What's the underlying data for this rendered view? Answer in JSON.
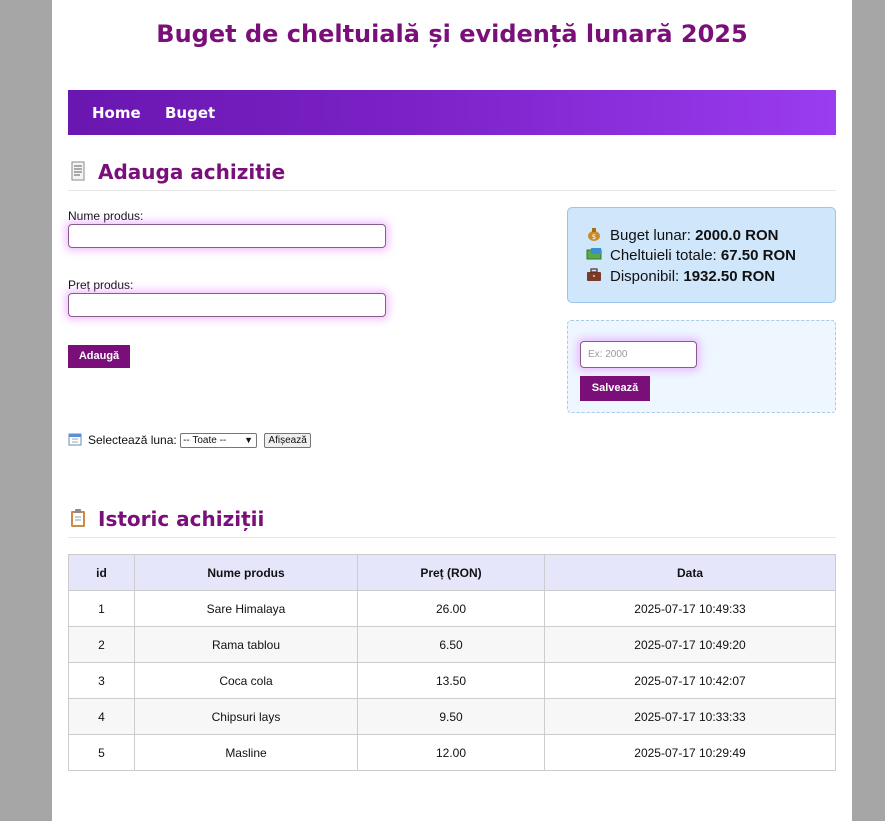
{
  "header": {
    "title": "Buget de cheltuială și evidență lunară 2025"
  },
  "nav": {
    "items": [
      {
        "label": "Home"
      },
      {
        "label": "Buget"
      }
    ]
  },
  "add_section": {
    "title": "Adauga achizitie",
    "name_label": "Nume produs:",
    "name_value": "",
    "price_label": "Preț produs:",
    "price_value": "",
    "submit_label": "Adaugă"
  },
  "summary": {
    "budget_label": "Buget lunar:",
    "budget_value": "2000.0 RON",
    "spent_label": "Cheltuieli totale:",
    "spent_value": "67.50 RON",
    "available_label": "Disponibil:",
    "available_value": "1932.50 RON"
  },
  "budget_form": {
    "placeholder": "Ex: 2000",
    "save_label": "Salvează"
  },
  "month_filter": {
    "label": "Selectează luna:",
    "selected": "-- Toate --",
    "show_label": "Afișează"
  },
  "history": {
    "title": "Istoric achiziții",
    "columns": [
      "id",
      "Nume produs",
      "Preț (RON)",
      "Data"
    ],
    "rows": [
      [
        "1",
        "Sare Himalaya",
        "26.00",
        "2025-07-17 10:49:33"
      ],
      [
        "2",
        "Rama tablou",
        "6.50",
        "2025-07-17 10:49:20"
      ],
      [
        "3",
        "Coca cola",
        "13.50",
        "2025-07-17 10:42:07"
      ],
      [
        "4",
        "Chipsuri lays",
        "9.50",
        "2025-07-17 10:33:33"
      ],
      [
        "5",
        "Masline",
        "12.00",
        "2025-07-17 10:29:49"
      ]
    ]
  },
  "colors": {
    "accent": "#7a0f7a",
    "nav_start": "#6a16b0",
    "nav_end": "#9a3cf0",
    "summary_bg": "#cfe6fb"
  },
  "icons": [
    "receipt-icon",
    "money-bag-icon",
    "banknotes-icon",
    "briefcase-icon",
    "calendar-icon",
    "clipboard-icon"
  ]
}
